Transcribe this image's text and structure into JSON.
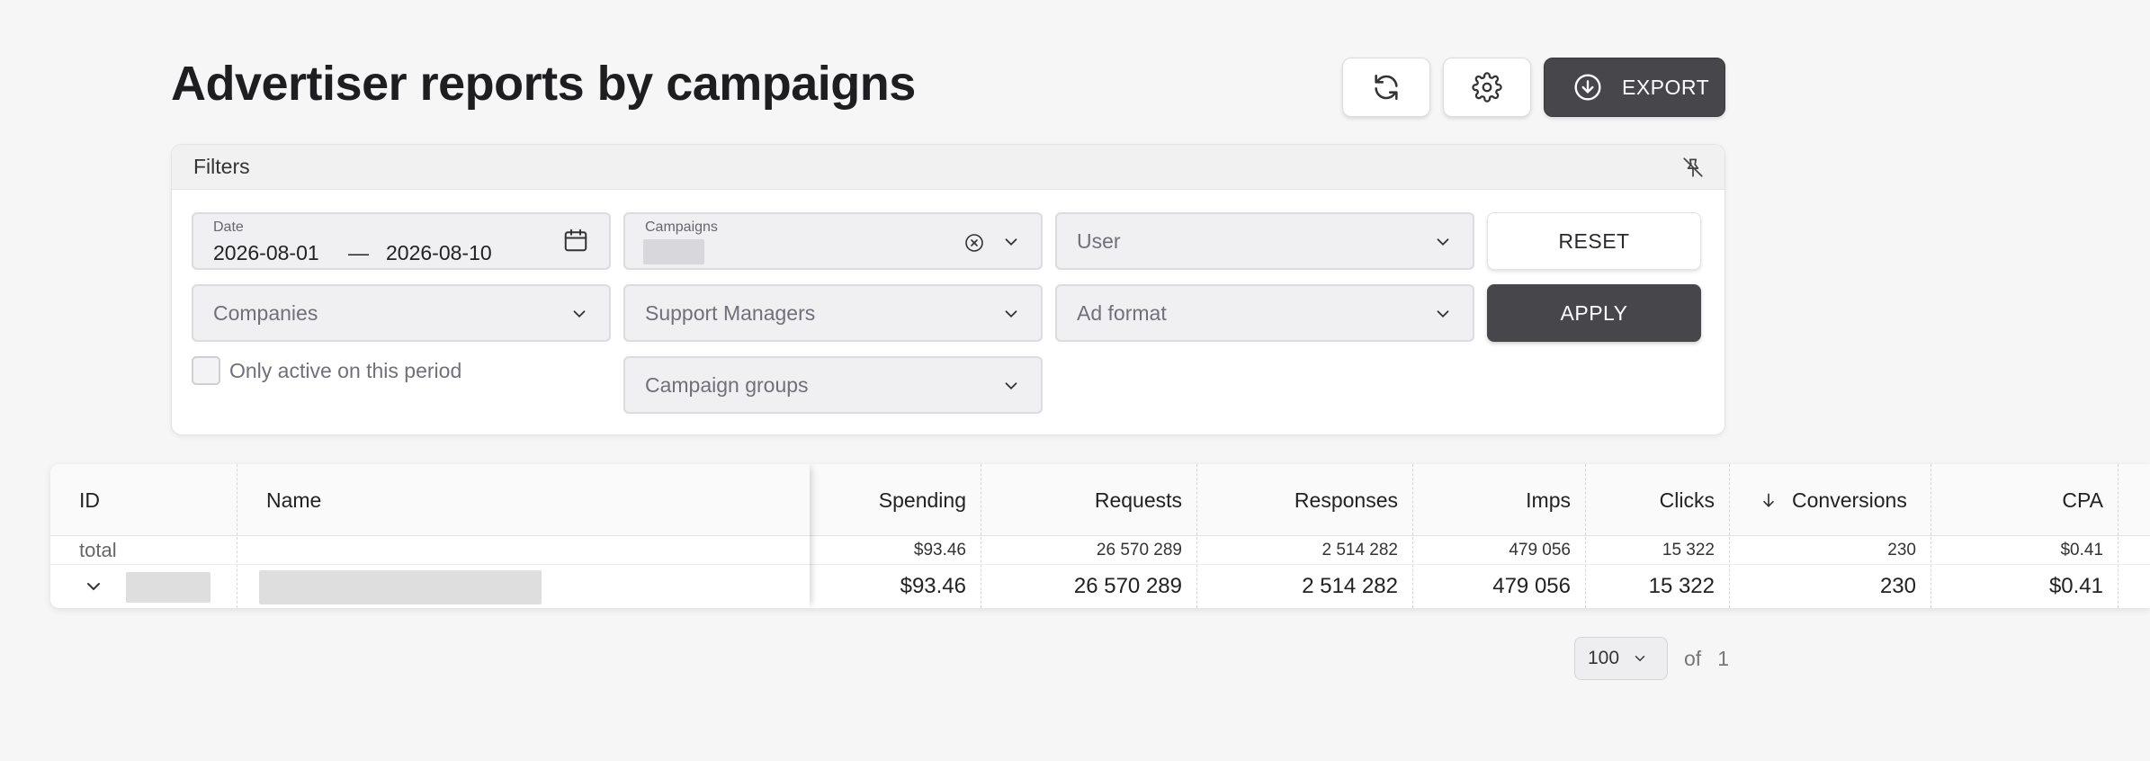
{
  "page": {
    "title": "Advertiser reports by campaigns"
  },
  "toolbar": {
    "export_label": "EXPORT"
  },
  "filters": {
    "header": "Filters",
    "date": {
      "label": "Date",
      "from": "2026-08-01",
      "separator": "—",
      "to": "2026-08-10"
    },
    "campaigns": {
      "label": "Campaigns"
    },
    "user": {
      "placeholder": "User"
    },
    "companies": {
      "placeholder": "Companies"
    },
    "support_managers": {
      "placeholder": "Support Managers"
    },
    "ad_format": {
      "placeholder": "Ad format"
    },
    "campaign_groups": {
      "placeholder": "Campaign groups"
    },
    "only_active_label": "Only active on this period",
    "reset_label": "RESET",
    "apply_label": "APPLY"
  },
  "table": {
    "columns": {
      "id": "ID",
      "name": "Name",
      "spending": "Spending",
      "requests": "Requests",
      "responses": "Responses",
      "imps": "Imps",
      "clicks": "Clicks",
      "conversions": "Conversions",
      "cpa": "CPA"
    },
    "sorted_column": "conversions",
    "total": {
      "label": "total",
      "spending": "$93.46",
      "requests": "26 570 289",
      "responses": "2 514 282",
      "imps": "479 056",
      "clicks": "15 322",
      "conversions": "230",
      "cpa": "$0.41"
    },
    "row": {
      "spending": "$93.46",
      "requests": "26 570 289",
      "responses": "2 514 282",
      "imps": "479 056",
      "clicks": "15 322",
      "conversions": "230",
      "cpa": "$0.41"
    }
  },
  "pagination": {
    "page_size": "100",
    "of_label": "of",
    "total_pages": "1"
  }
}
